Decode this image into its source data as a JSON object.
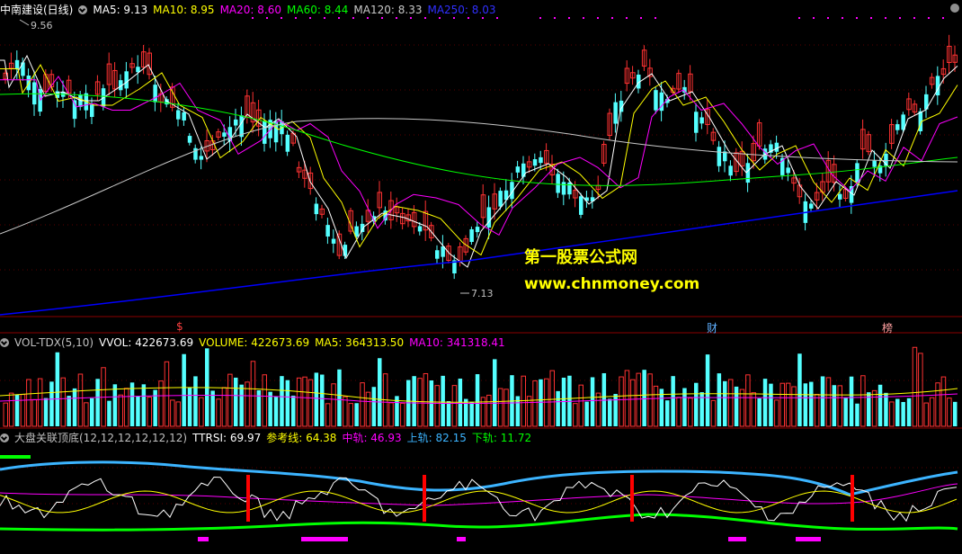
{
  "main": {
    "stock_title": "中南建设(日线)",
    "ma5": "MA5: 9.13",
    "ma10": "MA10: 8.95",
    "ma20": "MA20: 8.60",
    "ma60": "MA60: 8.44",
    "ma120": "MA120: 8.33",
    "ma250": "MA250: 8.03",
    "high_label": "9.56",
    "low_label": "7.13",
    "events": [
      "$",
      "财",
      "榜"
    ],
    "watermark_cn": "第一股票公式网",
    "watermark_url": "www.chnmoney.com"
  },
  "volume": {
    "title": "VOL-TDX(5,10)",
    "vvol": "VVOL: 422673.69",
    "volume": "VOLUME: 422673.69",
    "ma5": "MA5: 364313.50",
    "ma10": "MA10: 341318.41"
  },
  "indicator": {
    "title": "大盘关联顶底(12,12,12,12,12,12)",
    "ttrsi": "TTRSI: 69.97",
    "ref": "参考线: 64.38",
    "mid": "中轨: 46.93",
    "upper": "上轨: 82.15",
    "lower": "下轨: 11.72"
  },
  "colors": {
    "up": "#ff3232",
    "down": "#54ffff",
    "ma5": "#ffffff",
    "ma10": "#ffff00",
    "ma20": "#ff00ff",
    "ma60": "#00ff00",
    "ma120": "#c8c8c8",
    "ma250": "#0000ff"
  }
}
